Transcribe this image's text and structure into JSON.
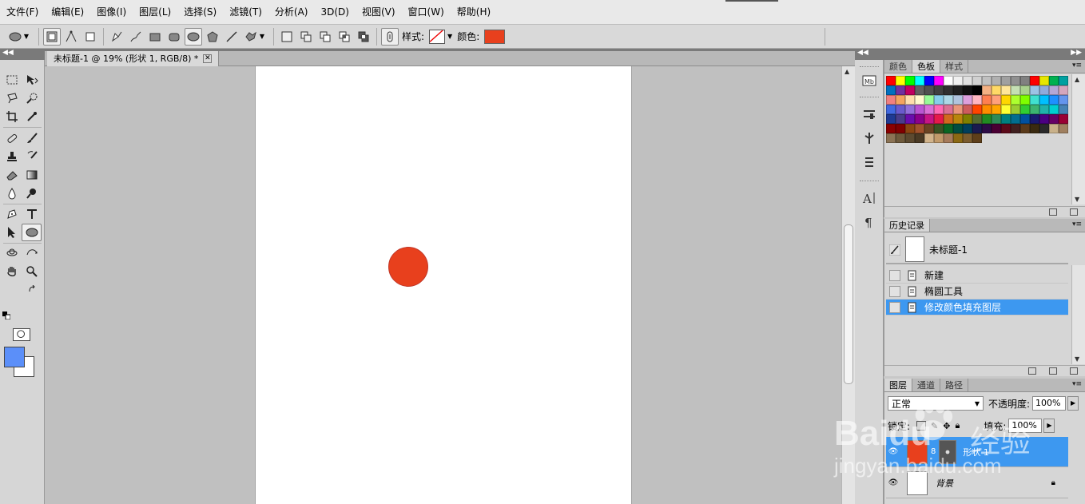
{
  "menu": [
    "文件(F)",
    "编辑(E)",
    "图像(I)",
    "图层(L)",
    "选择(S)",
    "滤镜(T)",
    "分析(A)",
    "3D(D)",
    "视图(V)",
    "窗口(W)",
    "帮助(H)"
  ],
  "options": {
    "style_label": "样式:",
    "color_label": "颜色:",
    "fill_color": "#e8401d"
  },
  "document": {
    "tab_title": "未标题-1 @ 19% (形状 1, RGB/8) *",
    "close_glyph": "✕",
    "circle_color": "#e8401d"
  },
  "toolbox": {
    "foreground": "#5b8ff9",
    "background": "#ffffff"
  },
  "swatches_panel": {
    "tabs": [
      "颜色",
      "色板",
      "样式"
    ],
    "active_tab": 1,
    "colors": [
      "#ff0000",
      "#ffff00",
      "#00ff00",
      "#00ffff",
      "#0000ff",
      "#ff00ff",
      "#ffffff",
      "#f0f0f0",
      "#e0e0e0",
      "#d0d0d0",
      "#c0c0c0",
      "#b0b0b0",
      "#a0a0a0",
      "#909090",
      "#808080",
      "#ff0000",
      "#e6e600",
      "#00b050",
      "#00a0a0",
      "#0070c0",
      "#7030a0",
      "#c00060",
      "#606060",
      "#505050",
      "#404040",
      "#303030",
      "#202020",
      "#101010",
      "#000000",
      "#f4b183",
      "#ffd966",
      "#ffe699",
      "#c5e0b4",
      "#a9d18e",
      "#9dc3e6",
      "#8faadc",
      "#b4a7d6",
      "#d5a6bd",
      "#f08080",
      "#f4a460",
      "#ffdead",
      "#fffacd",
      "#98fb98",
      "#87ceeb",
      "#add8e6",
      "#b0c4de",
      "#dda0dd",
      "#ffb6c1",
      "#ff7f50",
      "#ffa07a",
      "#ffd700",
      "#adff2f",
      "#7fff00",
      "#40e0d0",
      "#00bfff",
      "#1e90ff",
      "#6495ed",
      "#4169e1",
      "#6a5acd",
      "#9370db",
      "#ba55d3",
      "#da70d6",
      "#ff69b4",
      "#db7093",
      "#e9967a",
      "#cd5c5c",
      "#ff4500",
      "#ff8c00",
      "#ffa500",
      "#ffff33",
      "#9acd32",
      "#32cd32",
      "#3cb371",
      "#20b2aa",
      "#00ced1",
      "#4682b4",
      "#1f3a93",
      "#483d8b",
      "#6a0dad",
      "#8b008b",
      "#c71585",
      "#e6194b",
      "#d2691e",
      "#b8860b",
      "#808000",
      "#556b2f",
      "#228b22",
      "#2e8b57",
      "#008080",
      "#006d8f",
      "#00509e",
      "#191970",
      "#4b0082",
      "#660066",
      "#990033",
      "#8b0000",
      "#800000",
      "#8b4513",
      "#a0522d",
      "#6b4423",
      "#3b5323",
      "#0b6623",
      "#004d40",
      "#003f5c",
      "#1a1a4f",
      "#2d0b45",
      "#4a0033",
      "#5c0a1a",
      "#402020",
      "#5a3a1a",
      "#3a2a10",
      "#2a2a2a",
      "#c9b18a",
      "#a08060",
      "#8b7355",
      "#6e5a3c",
      "#5c4a30",
      "#4a3a24",
      "#d2b48c",
      "#c19a6b",
      "#a67b5b",
      "#8b6914",
      "#7b5c2e",
      "#5e3f1a"
    ]
  },
  "history_panel": {
    "tab": "历史记录",
    "snapshot_label": "未标题-1",
    "items": [
      "新建",
      "椭圆工具",
      "修改颜色填充图层"
    ],
    "selected_index": 2
  },
  "layers_panel": {
    "tabs": [
      "图层",
      "通道",
      "路径"
    ],
    "blend_mode": "正常",
    "opacity_label": "不透明度:",
    "opacity_value": "100%",
    "lock_label": "锁定:",
    "fill_label": "填充:",
    "fill_value": "100%",
    "layers": [
      {
        "name": "形状 1",
        "selected": true
      },
      {
        "name": "背景",
        "selected": false
      }
    ]
  },
  "watermark": {
    "brand": "Baidu",
    "brand_cn": "经验",
    "url": "jingyan.baidu.com"
  }
}
